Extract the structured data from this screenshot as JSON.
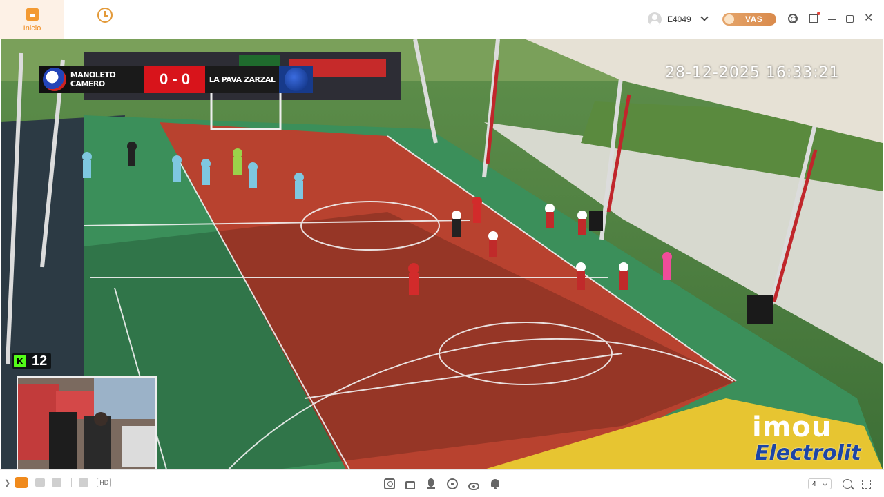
{
  "nav": {
    "home_label": "Inicio"
  },
  "user": {
    "name": "E4049",
    "vas_label": "VAS"
  },
  "video": {
    "scoreboard": {
      "home_team": "MANOLETO CAMERO",
      "score": "0 - 0",
      "away_team": "LA PAVA ZARZAL"
    },
    "timestamp": "28-12-2025 16:33:21",
    "viewer_count": "12",
    "kick_letter": "K",
    "watermark_imou": "imou",
    "watermark_electrolit": "Electrolit"
  },
  "bottom": {
    "quality_label": "HD",
    "split_value": "4"
  },
  "colors": {
    "accent": "#f08a1c",
    "score_red": "#d8141b",
    "court_red": "#b8422f",
    "court_green": "#3b8f5a",
    "court_yellow": "#e7c531"
  }
}
